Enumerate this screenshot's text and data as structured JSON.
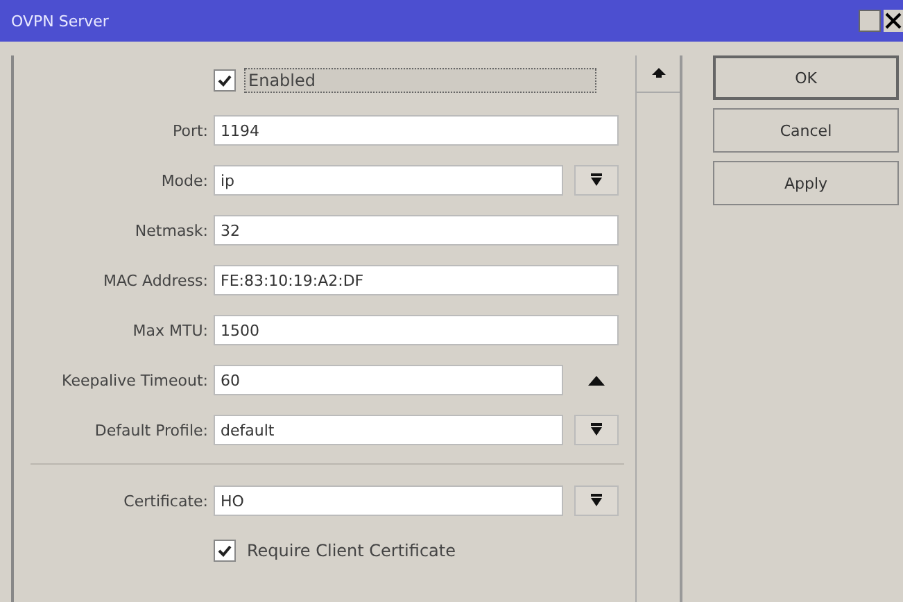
{
  "window": {
    "title": "OVPN Server"
  },
  "fields": [
    {
      "kind": "checkbox",
      "label": "Enabled",
      "checked": true,
      "focused": true
    },
    {
      "kind": "text",
      "label": "Port:",
      "value": "1194"
    },
    {
      "kind": "select",
      "label": "Mode:",
      "value": "ip"
    },
    {
      "kind": "text",
      "label": "Netmask:",
      "value": "32"
    },
    {
      "kind": "text",
      "label": "MAC Address:",
      "value": "FE:83:10:19:A2:DF"
    },
    {
      "kind": "text",
      "label": "Max MTU:",
      "value": "1500"
    },
    {
      "kind": "collapsible",
      "label": "Keepalive Timeout:",
      "value": "60"
    },
    {
      "kind": "select",
      "label": "Default Profile:",
      "value": "default"
    },
    {
      "kind": "separator"
    },
    {
      "kind": "select",
      "label": "Certificate:",
      "value": "HO"
    },
    {
      "kind": "checkbox",
      "label": "Require Client Certificate",
      "checked": true,
      "focused": false
    }
  ],
  "buttons": [
    "OK",
    "Cancel",
    "Apply"
  ]
}
